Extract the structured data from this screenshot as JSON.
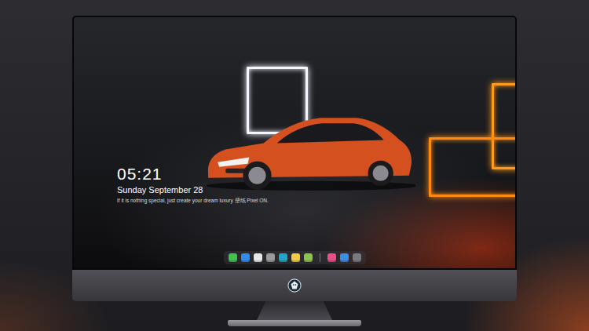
{
  "lock_screen": {
    "time": "05:21",
    "date": "Sunday September 28",
    "motto": "If it is nothing special, just create your dream luxury 壁纸  Pixel ON."
  },
  "dock": {
    "apps": [
      {
        "color": "#3fc24e"
      },
      {
        "color": "#2f8cf0"
      },
      {
        "color": "#e8e8e8"
      },
      {
        "color": "#9a9a9a"
      },
      {
        "color": "#1ea7c8"
      },
      {
        "color": "#f5c842"
      },
      {
        "color": "#8bc34a"
      }
    ],
    "recent": [
      {
        "color": "#e94d8a"
      },
      {
        "color": "#3a8ee6"
      },
      {
        "color": "#7a7a80"
      }
    ]
  }
}
